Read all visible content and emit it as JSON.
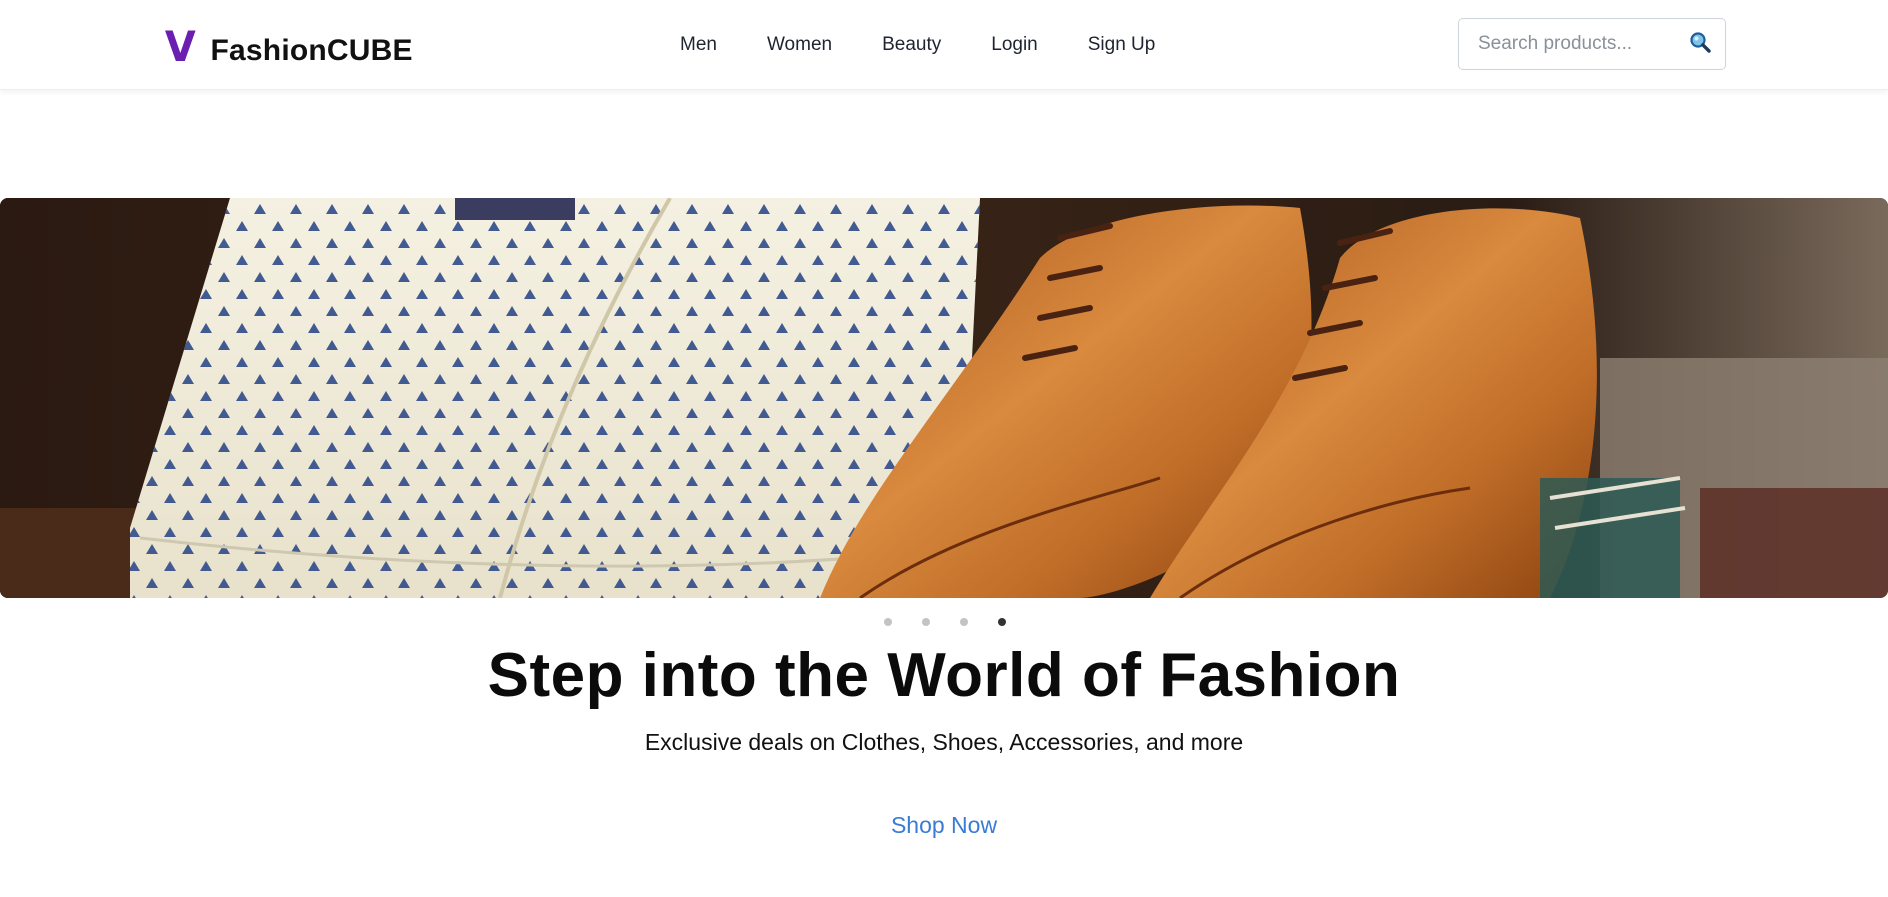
{
  "brand": {
    "logo_letter": "V",
    "name": "FashionCUBE",
    "accent_color": "#6a1fb0"
  },
  "nav": {
    "items": [
      {
        "label": "Men"
      },
      {
        "label": "Women"
      },
      {
        "label": "Beauty"
      },
      {
        "label": "Login"
      },
      {
        "label": "Sign Up"
      }
    ]
  },
  "search": {
    "placeholder": "Search products...",
    "value": "",
    "icon": "magnifier-icon"
  },
  "hero": {
    "image": "folded-shirts-and-brown-leather-shoes",
    "carousel": {
      "slide_count": 4,
      "active_index": 4
    }
  },
  "headline": "Step into the World of Fashion",
  "subheadline": "Exclusive deals on Clothes, Shoes, Accessories, and more",
  "cta": {
    "label": "Shop Now",
    "color": "#3a7bd5"
  }
}
